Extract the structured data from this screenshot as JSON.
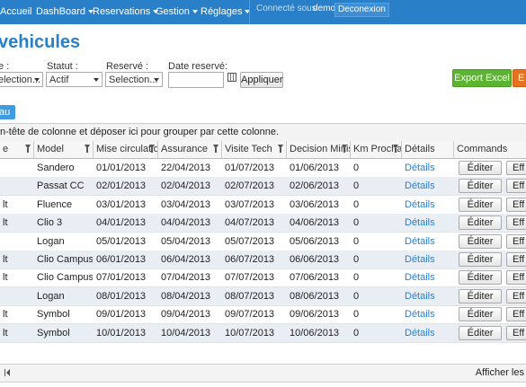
{
  "nav": {
    "items": [
      {
        "label": "Accueil",
        "caret": false
      },
      {
        "label": "DashBoard",
        "caret": true
      },
      {
        "label": "Reservations",
        "caret": true
      },
      {
        "label": "Gestion",
        "caret": true
      },
      {
        "label": "Réglages",
        "caret": true
      }
    ],
    "connected_text": "Connecté sous",
    "user": "demo",
    "logout": "Deconexion"
  },
  "page_title": "vehicules",
  "filters": {
    "type": {
      "label": "e :",
      "value": "election..."
    },
    "statut": {
      "label": "Statut :",
      "value": "Actif"
    },
    "reserve": {
      "label": "Reservé :",
      "value": "Selection..."
    },
    "date": {
      "label": "Date reservé:",
      "value": ""
    },
    "apply": "Appliquer"
  },
  "actions": {
    "export_excel": "Export Excel",
    "export_other": "E",
    "new": "au"
  },
  "group_hint": "n-tête de colonne et déposer ici pour grouper par cette colonne.",
  "table": {
    "columns": [
      {
        "label": "e",
        "filter": true
      },
      {
        "label": "Model",
        "filter": true
      },
      {
        "label": "Mise circulation",
        "filter": true
      },
      {
        "label": "Assurance",
        "filter": true
      },
      {
        "label": "Visite Tech",
        "filter": true
      },
      {
        "label": "Decision Minist",
        "filter": true
      },
      {
        "label": "Km Prochain",
        "filter": true
      },
      {
        "label": "Détails",
        "filter": false
      },
      {
        "label": "Commands",
        "filter": false
      }
    ],
    "rows": [
      {
        "make": "",
        "model": "Sandero",
        "mise": "01/01/2013",
        "assurance": "22/04/2013",
        "visite": "01/07/2013",
        "decision": "01/06/2013",
        "km": "0",
        "details": "Détails",
        "edit": "Éditer",
        "del": "Eff"
      },
      {
        "make": "",
        "model": "Passat CC",
        "mise": "02/01/2013",
        "assurance": "02/04/2013",
        "visite": "02/07/2013",
        "decision": "02/06/2013",
        "km": "0",
        "details": "Détails",
        "edit": "Éditer",
        "del": "Eff"
      },
      {
        "make": "lt",
        "model": "Fluence",
        "mise": "03/01/2013",
        "assurance": "03/04/2013",
        "visite": "03/07/2013",
        "decision": "03/06/2013",
        "km": "0",
        "details": "Détails",
        "edit": "Éditer",
        "del": "Eff"
      },
      {
        "make": "lt",
        "model": "Clio 3",
        "mise": "04/01/2013",
        "assurance": "04/04/2013",
        "visite": "04/07/2013",
        "decision": "04/06/2013",
        "km": "0",
        "details": "Détails",
        "edit": "Éditer",
        "del": "Eff"
      },
      {
        "make": "",
        "model": "Logan",
        "mise": "05/01/2013",
        "assurance": "05/04/2013",
        "visite": "05/07/2013",
        "decision": "05/06/2013",
        "km": "0",
        "details": "Détails",
        "edit": "Éditer",
        "del": "Eff"
      },
      {
        "make": "lt",
        "model": "Clio Campus",
        "mise": "06/01/2013",
        "assurance": "06/04/2013",
        "visite": "06/07/2013",
        "decision": "06/06/2013",
        "km": "0",
        "details": "Détails",
        "edit": "Éditer",
        "del": "Eff"
      },
      {
        "make": "lt",
        "model": "Clio Campus",
        "mise": "07/01/2013",
        "assurance": "07/04/2013",
        "visite": "07/07/2013",
        "decision": "07/06/2013",
        "km": "0",
        "details": "Détails",
        "edit": "Éditer",
        "del": "Eff"
      },
      {
        "make": "",
        "model": "Logan",
        "mise": "08/01/2013",
        "assurance": "08/04/2013",
        "visite": "08/07/2013",
        "decision": "08/06/2013",
        "km": "0",
        "details": "Détails",
        "edit": "Éditer",
        "del": "Eff"
      },
      {
        "make": "lt",
        "model": "Symbol",
        "mise": "09/01/2013",
        "assurance": "09/04/2013",
        "visite": "09/07/2013",
        "decision": "09/06/2013",
        "km": "0",
        "details": "Détails",
        "edit": "Éditer",
        "del": "Eff"
      },
      {
        "make": "lt",
        "model": "Symbol",
        "mise": "10/01/2013",
        "assurance": "10/04/2013",
        "visite": "10/07/2013",
        "decision": "10/06/2013",
        "km": "0",
        "details": "Détails",
        "edit": "Éditer",
        "del": "Eff"
      }
    ]
  },
  "footer": {
    "info": "Afficher les"
  },
  "colors": {
    "accent": "#2a80c8",
    "excel": "#5cb531",
    "export_other": "#e8721c",
    "link": "#2a7fd0",
    "row_alt": "#e9eef5"
  }
}
